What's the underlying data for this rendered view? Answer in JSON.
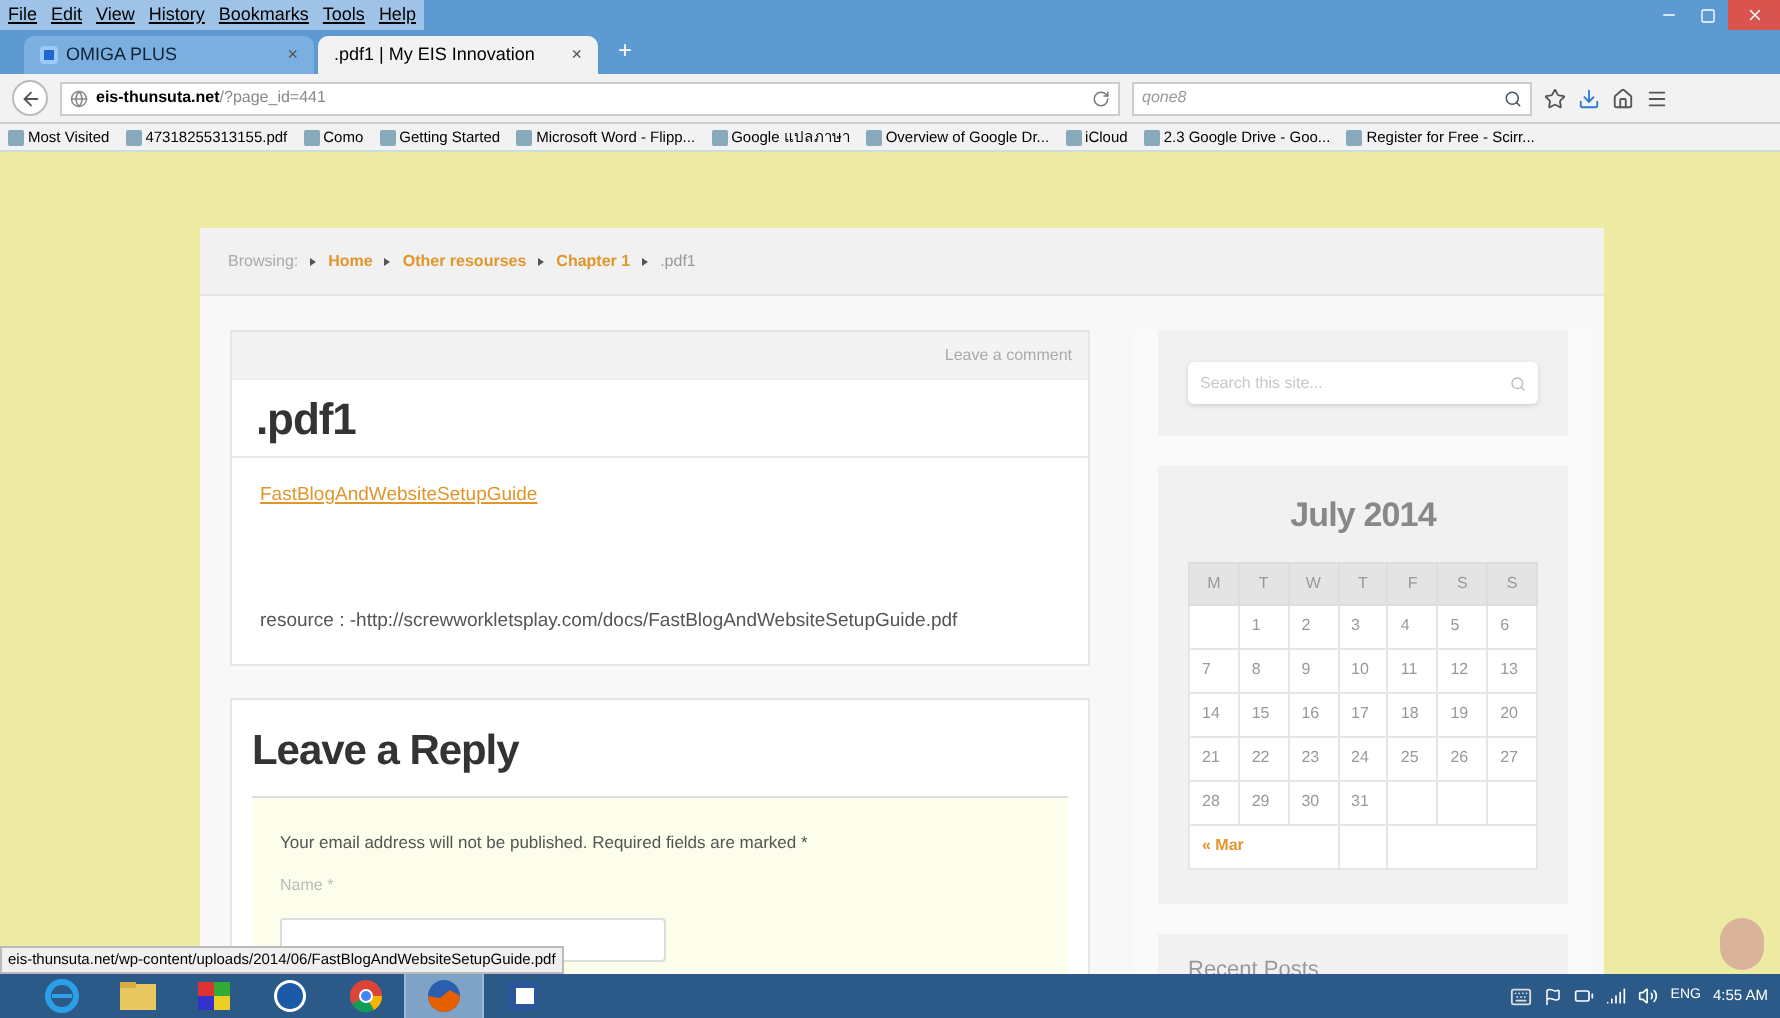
{
  "menu": [
    "File",
    "Edit",
    "View",
    "History",
    "Bookmarks",
    "Tools",
    "Help"
  ],
  "tabs": [
    {
      "label": "OMIGA PLUS",
      "close": "×",
      "selected": false
    },
    {
      "label": ".pdf1 | My EIS Innovation",
      "close": "×",
      "selected": true
    }
  ],
  "new_tab": "+",
  "address": {
    "domain": "eis-thunsuta.net",
    "path": "/?page_id=441"
  },
  "search_box": {
    "placeholder": "qone8"
  },
  "bookmarks": [
    "Most Visited",
    "47318255313155.pdf",
    "Como",
    "Getting Started",
    "Microsoft Word - Flipp...",
    "Google แปลภาษา",
    "Overview of Google Dr...",
    "iCloud",
    "2.3 Google Drive - Goo...",
    "Register for Free - Scirr..."
  ],
  "breadcrumb": {
    "label": "Browsing:",
    "links": [
      "Home",
      "Other resourses",
      "Chapter 1"
    ],
    "current": ".pdf1"
  },
  "post": {
    "comment_link": "Leave a comment",
    "title": ".pdf1",
    "file_link": "FastBlogAndWebsiteSetupGuide",
    "resource": "resource : -http://screwworkletsplay.com/docs/FastBlogAndWebsiteSetupGuide.pdf"
  },
  "reply": {
    "title": "Leave a Reply",
    "notice": "Your email address will not be published. Required fields are marked *",
    "name_label": "Name *"
  },
  "site_search": {
    "placeholder": "Search this site..."
  },
  "calendar": {
    "title": "July 2014",
    "weekdays": [
      "M",
      "T",
      "W",
      "T",
      "F",
      "S",
      "S"
    ],
    "weeks": [
      [
        "1",
        "2",
        "3",
        "4",
        "5",
        "6"
      ],
      [
        "7",
        "8",
        "9",
        "10",
        "11",
        "12",
        "13"
      ],
      [
        "14",
        "15",
        "16",
        "17",
        "18",
        "19",
        "20"
      ],
      [
        "21",
        "22",
        "23",
        "24",
        "25",
        "26",
        "27"
      ],
      [
        "28",
        "29",
        "30",
        "31"
      ]
    ],
    "prev": "« Mar"
  },
  "recent_posts": {
    "title": "Recent Posts"
  },
  "status_url": "eis-thunsuta.net/wp-content/uploads/2014/06/FastBlogAndWebsiteSetupGuide.pdf",
  "taskbar": [
    {
      "kind": "ie",
      "selected": false
    },
    {
      "kind": "folder",
      "selected": false
    },
    {
      "kind": "media",
      "selected": false
    },
    {
      "kind": "hp",
      "selected": false
    },
    {
      "kind": "chrome",
      "selected": false
    },
    {
      "kind": "firefox",
      "selected": true
    },
    {
      "kind": "word",
      "selected": false
    }
  ],
  "tray": {
    "language": "ENG",
    "time": "4:55 AM"
  }
}
